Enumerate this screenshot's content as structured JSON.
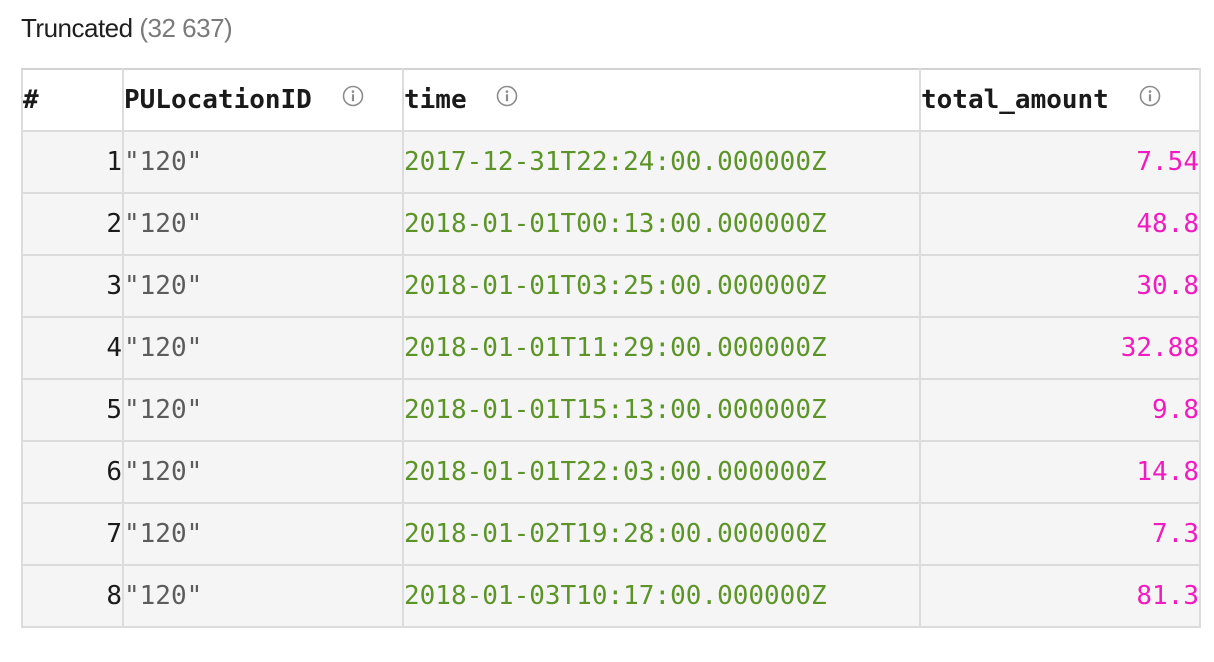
{
  "header": {
    "title": "Truncated",
    "count": "(32 637)"
  },
  "table": {
    "columns": [
      {
        "label": "#",
        "icon": null
      },
      {
        "label": "PULocationID",
        "icon": "info-icon"
      },
      {
        "label": "time",
        "icon": "info-icon"
      },
      {
        "label": "total_amount",
        "icon": "info-icon"
      }
    ],
    "rows": [
      {
        "num": "1",
        "pu": "\"120\"",
        "time": "2017-12-31T22:24:00.000000Z",
        "amount": "7.54"
      },
      {
        "num": "2",
        "pu": "\"120\"",
        "time": "2018-01-01T00:13:00.000000Z",
        "amount": "48.8"
      },
      {
        "num": "3",
        "pu": "\"120\"",
        "time": "2018-01-01T03:25:00.000000Z",
        "amount": "30.8"
      },
      {
        "num": "4",
        "pu": "\"120\"",
        "time": "2018-01-01T11:29:00.000000Z",
        "amount": "32.88"
      },
      {
        "num": "5",
        "pu": "\"120\"",
        "time": "2018-01-01T15:13:00.000000Z",
        "amount": "9.8"
      },
      {
        "num": "6",
        "pu": "\"120\"",
        "time": "2018-01-01T22:03:00.000000Z",
        "amount": "14.8"
      },
      {
        "num": "7",
        "pu": "\"120\"",
        "time": "2018-01-02T19:28:00.000000Z",
        "amount": "7.3"
      },
      {
        "num": "8",
        "pu": "\"120\"",
        "time": "2018-01-03T10:17:00.000000Z",
        "amount": "81.3"
      }
    ]
  },
  "colors": {
    "string_value": "#5c5c5c",
    "datetime_value": "#5c9428",
    "number_value": "#f21bbf",
    "border": "#dcdcdc",
    "row_background": "#f5f5f5"
  }
}
